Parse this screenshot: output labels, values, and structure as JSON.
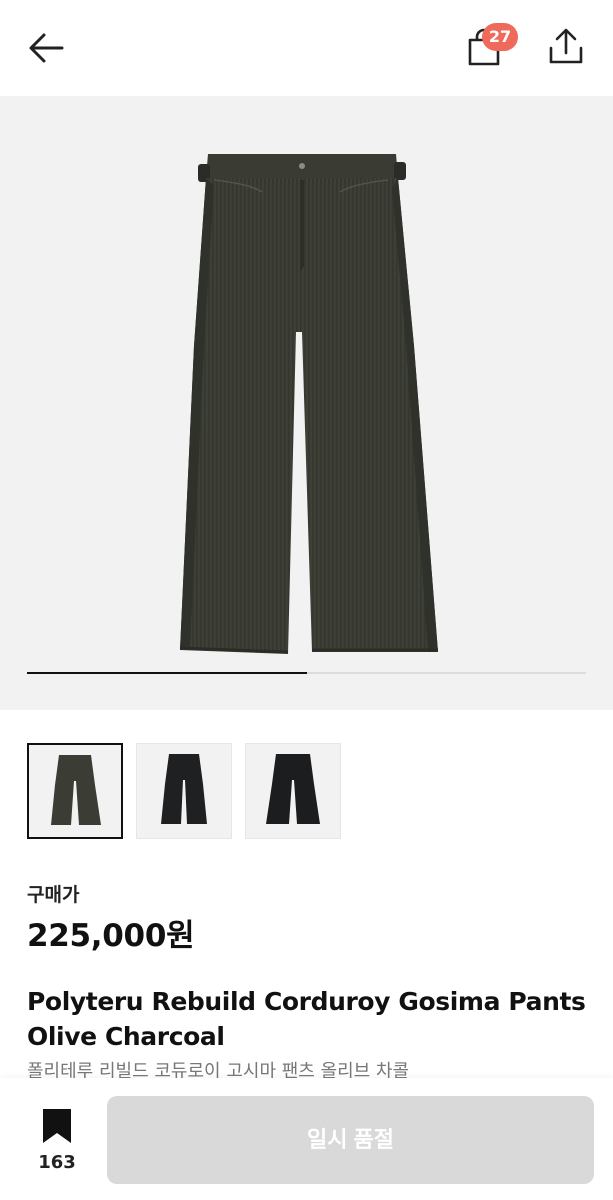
{
  "header": {
    "back_icon": "arrow-left-icon",
    "bag_icon": "shopping-bag-icon",
    "bag_count": "27",
    "share_icon": "share-icon",
    "badge_color": "#ef6a5a"
  },
  "gallery": {
    "main_image": "olive-charcoal-corduroy-pants",
    "progress_fraction": 0.5,
    "thumbnails": [
      {
        "name": "olive-charcoal-pants",
        "selected": true,
        "color": "#3b3d35"
      },
      {
        "name": "black-pants",
        "selected": false,
        "color": "#1e2022"
      },
      {
        "name": "black-pants-alt",
        "selected": false,
        "color": "#1c1d1f"
      }
    ]
  },
  "product": {
    "price_label": "구매가",
    "price": "225,000원",
    "title": "Polyteru Rebuild Corduroy Gosima Pants Olive Charcoal",
    "subtitle": "폴리테루 리빌드 코듀로이 고시마 팬츠 올리브 차콜"
  },
  "bottom": {
    "bookmark_icon": "bookmark-icon",
    "bookmark_count": "163",
    "action_label": "일시 품절",
    "action_bg": "#d9d9d9"
  }
}
